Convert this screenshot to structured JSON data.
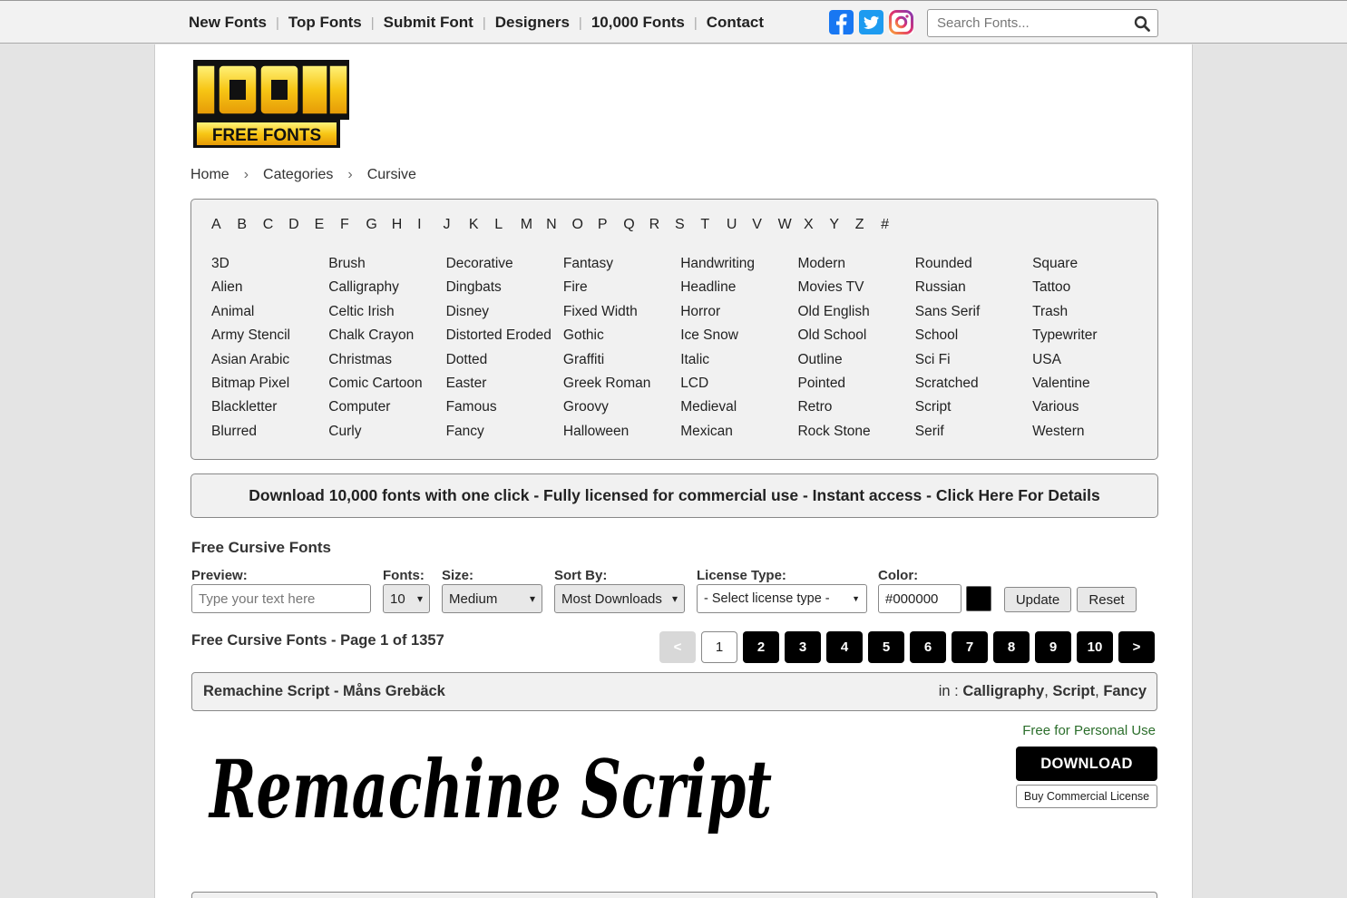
{
  "nav": {
    "items": [
      "New Fonts",
      "Top Fonts",
      "Submit Font",
      "Designers",
      "10,000 Fonts",
      "Contact"
    ]
  },
  "social": {
    "icons": [
      "facebook-icon",
      "twitter-icon",
      "instagram-icon"
    ]
  },
  "search": {
    "placeholder": "Search Fonts..."
  },
  "logo": {
    "text_top": "1001",
    "text_bottom": "FREE FONTS"
  },
  "breadcrumb": [
    "Home",
    "Categories",
    "Cursive"
  ],
  "letters": [
    "A",
    "B",
    "C",
    "D",
    "E",
    "F",
    "G",
    "H",
    "I",
    "J",
    "K",
    "L",
    "M",
    "N",
    "O",
    "P",
    "Q",
    "R",
    "S",
    "T",
    "U",
    "V",
    "W",
    "X",
    "Y",
    "Z",
    "#"
  ],
  "categories": [
    [
      "3D",
      "Alien",
      "Animal",
      "Army Stencil",
      "Asian Arabic",
      "Bitmap Pixel",
      "Blackletter",
      "Blurred"
    ],
    [
      "Brush",
      "Calligraphy",
      "Celtic Irish",
      "Chalk Crayon",
      "Christmas",
      "Comic Cartoon",
      "Computer",
      "Curly"
    ],
    [
      "Decorative",
      "Dingbats",
      "Disney",
      "Distorted Eroded",
      "Dotted",
      "Easter",
      "Famous",
      "Fancy"
    ],
    [
      "Fantasy",
      "Fire",
      "Fixed Width",
      "Gothic",
      "Graffiti",
      "Greek Roman",
      "Groovy",
      "Halloween"
    ],
    [
      "Handwriting",
      "Headline",
      "Horror",
      "Ice Snow",
      "Italic",
      "LCD",
      "Medieval",
      "Mexican"
    ],
    [
      "Modern",
      "Movies TV",
      "Old English",
      "Old School",
      "Outline",
      "Pointed",
      "Retro",
      "Rock Stone"
    ],
    [
      "Rounded",
      "Russian",
      "Sans Serif",
      "School",
      "Sci Fi",
      "Scratched",
      "Script",
      "Serif"
    ],
    [
      "Square",
      "Tattoo",
      "Trash",
      "Typewriter",
      "USA",
      "Valentine",
      "Various",
      "Western"
    ]
  ],
  "promo": "Download 10,000 fonts with one click - Fully licensed for commercial use - Instant access - Click Here For Details",
  "section_title": "Free Cursive Fonts",
  "filters": {
    "preview_label": "Preview:",
    "preview_placeholder": "Type your text here",
    "fonts_label": "Fonts:",
    "fonts_value": "10",
    "size_label": "Size:",
    "size_value": "Medium",
    "sort_label": "Sort By:",
    "sort_value": "Most Downloads",
    "license_label": "License Type:",
    "license_value": "- Select license type -",
    "color_label": "Color:",
    "color_value": "#000000",
    "swatch_color": "#000000",
    "update": "Update",
    "reset": "Reset"
  },
  "page_info": "Free Cursive Fonts - Page 1 of 1357",
  "pager": [
    "<",
    "1",
    "2",
    "3",
    "4",
    "5",
    "6",
    "7",
    "8",
    "9",
    "10",
    ">"
  ],
  "font": {
    "title": "Remachine Script - Måns Grebäck",
    "in_label": "in :",
    "categories": [
      "Calligraphy",
      "Script",
      "Fancy"
    ],
    "preview_text": "Remachine Script",
    "license": "Free for Personal Use",
    "download": "DOWNLOAD",
    "buy": "Buy Commercial License"
  }
}
